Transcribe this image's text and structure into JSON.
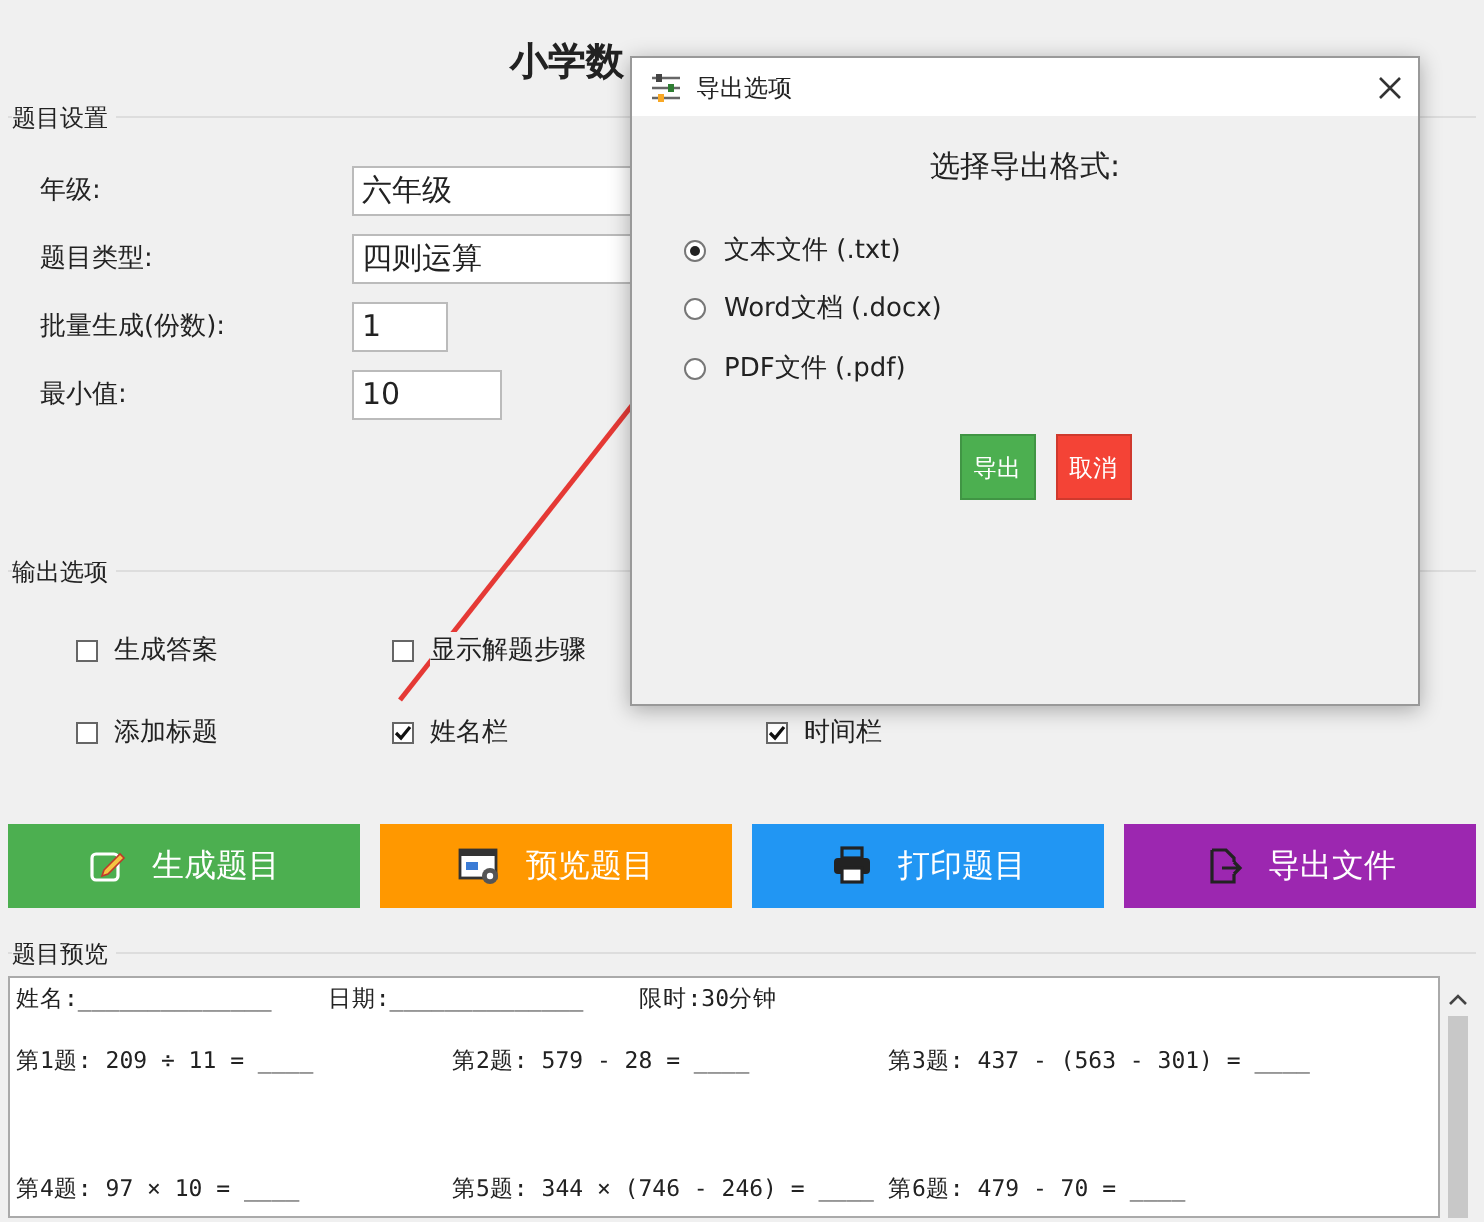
{
  "app_title": "小学数",
  "settings": {
    "title": "题目设置",
    "fields": [
      {
        "label": "年级:",
        "value": "六年级",
        "kind": "combo"
      },
      {
        "label": "题目类型:",
        "value": "四则运算",
        "kind": "combo"
      },
      {
        "label": "批量生成(份数):",
        "value": "1",
        "kind": "short"
      },
      {
        "label": "最小值:",
        "value": "10",
        "kind": "medium"
      }
    ]
  },
  "output_options": {
    "title": "输出选项",
    "rows": [
      [
        {
          "label": "生成答案",
          "checked": false
        },
        {
          "label": "显示解题步骤",
          "checked": false
        }
      ],
      [
        {
          "label": "添加标题",
          "checked": false
        },
        {
          "label": "姓名栏",
          "checked": true
        },
        {
          "label": "时间栏",
          "checked": true
        }
      ]
    ]
  },
  "actions": [
    {
      "label": "生成题目",
      "kind": "generate",
      "color": "#4caf50"
    },
    {
      "label": "预览题目",
      "kind": "preview",
      "color": "#ff9800"
    },
    {
      "label": "打印题目",
      "kind": "print",
      "color": "#2196f3"
    },
    {
      "label": "导出文件",
      "kind": "export",
      "color": "#9c27b0"
    }
  ],
  "preview": {
    "title": "题目预览",
    "header": [
      "姓名:______________",
      "日期:______________",
      "限时:30分钟"
    ],
    "problems": [
      [
        "第1题: 209 ÷ 11 = ____",
        "第2题: 579 - 28 = ____",
        "第3题: 437 - (563 - 301) = ____"
      ],
      [
        "第4题: 97 × 10 = ____",
        "第5题: 344 × (746 - 246) = ____",
        "第6题: 479 - 70 = ____"
      ]
    ]
  },
  "dialog": {
    "title": "导出选项",
    "heading": "选择导出格式:",
    "options": [
      {
        "label": "文本文件 (.txt)",
        "selected": true
      },
      {
        "label": "Word文档 (.docx)",
        "selected": false
      },
      {
        "label": "PDF文件 (.pdf)",
        "selected": false
      }
    ],
    "buttons": [
      {
        "label": "导出",
        "kind": "confirm"
      },
      {
        "label": "取消",
        "kind": "cancel"
      }
    ]
  }
}
